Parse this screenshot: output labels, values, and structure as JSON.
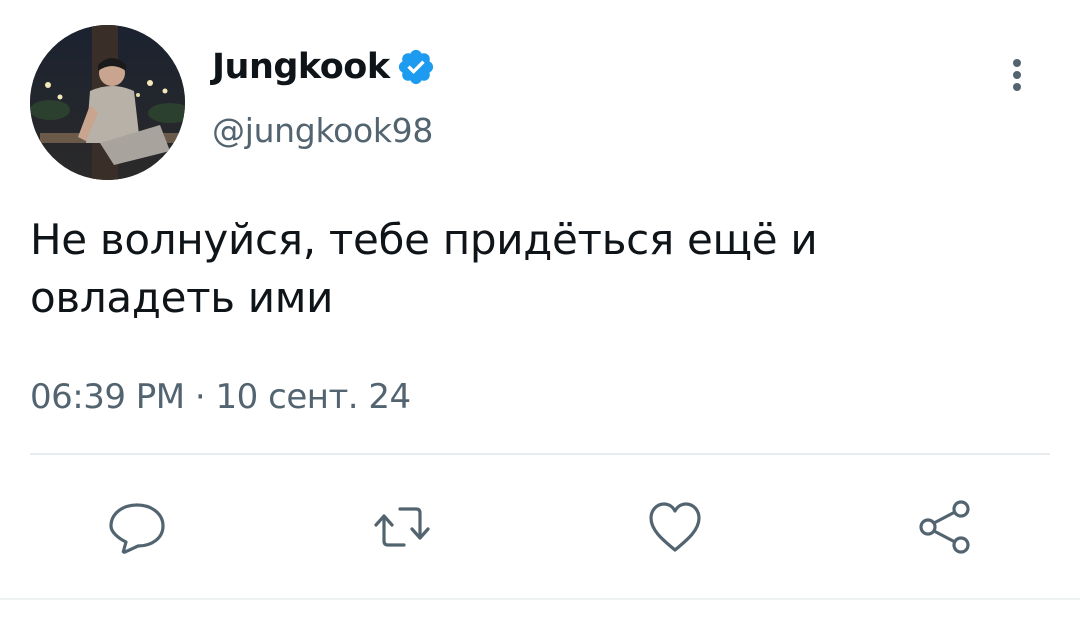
{
  "tweet": {
    "display_name": "Jungkook",
    "handle": "@jungkook98",
    "text_line1": "Не волнуйся, тебе придёться ещё и",
    "text_line2": "овладеть ими",
    "timestamp": "06:39 PM · 10 сент. 24",
    "verified": true
  },
  "icons": {
    "avatar": "avatar-photo",
    "verified": "verified-badge-icon",
    "more": "more-vertical-icon",
    "reply": "reply-icon",
    "retweet": "retweet-icon",
    "like": "heart-icon",
    "share": "share-icon"
  },
  "colors": {
    "text_primary": "#0f1419",
    "text_secondary": "#536471",
    "verified_blue": "#1d9bf0",
    "icon_gray": "#536471",
    "divider": "#e8ecef"
  }
}
